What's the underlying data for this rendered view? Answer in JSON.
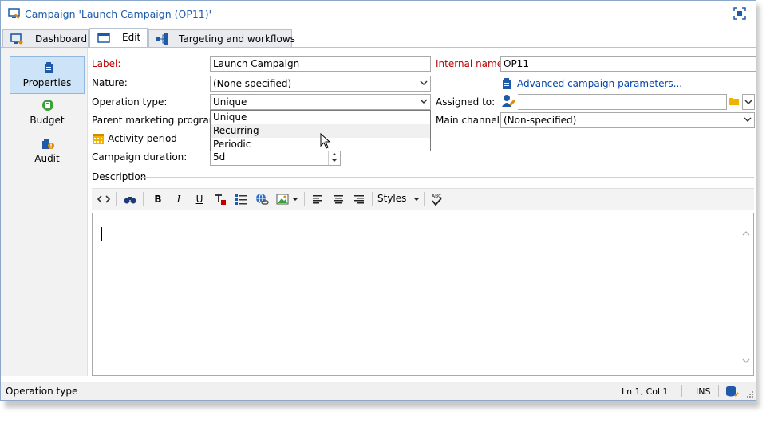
{
  "window": {
    "title": "Campaign 'Launch Campaign (OP11)'"
  },
  "tabs": [
    {
      "label": "Dashboard"
    },
    {
      "label": "Edit"
    },
    {
      "label": "Targeting and workflows"
    }
  ],
  "sidebar": {
    "items": [
      {
        "label": "Properties",
        "icon": "clipboard-icon"
      },
      {
        "label": "Budget",
        "icon": "calculator-icon"
      },
      {
        "label": "Audit",
        "icon": "audit-icon"
      }
    ]
  },
  "form": {
    "label_label": "Label:",
    "label_value": "Launch Campaign",
    "internal_name_label": "Internal name:",
    "internal_name_value": "OP11",
    "nature_label": "Nature:",
    "nature_value": "(None specified)",
    "advanced_link": "Advanced campaign parameters...",
    "operation_type_label": "Operation type:",
    "operation_type_value": "Unique",
    "assigned_to_label": "Assigned to:",
    "assigned_to_value": "",
    "parent_program_label": "Parent marketing program:",
    "main_channel_label": "Main channel:",
    "main_channel_value": "(Non-specified)",
    "activity_period_label": "Activity period",
    "campaign_duration_label": "Campaign duration:",
    "campaign_duration_value": "5d",
    "description_label": "Description"
  },
  "operation_type_options": [
    "Unique",
    "Recurring",
    "Periodic"
  ],
  "toolbar": {
    "styles_label": "Styles"
  },
  "status": {
    "left_text": "Operation type",
    "position": "Ln 1, Col 1",
    "mode": "INS"
  },
  "colors": {
    "required_label": "#c00000",
    "title_text": "#1e5aa8",
    "link": "#0645ad",
    "sidebar_active": "#cde3f7"
  }
}
